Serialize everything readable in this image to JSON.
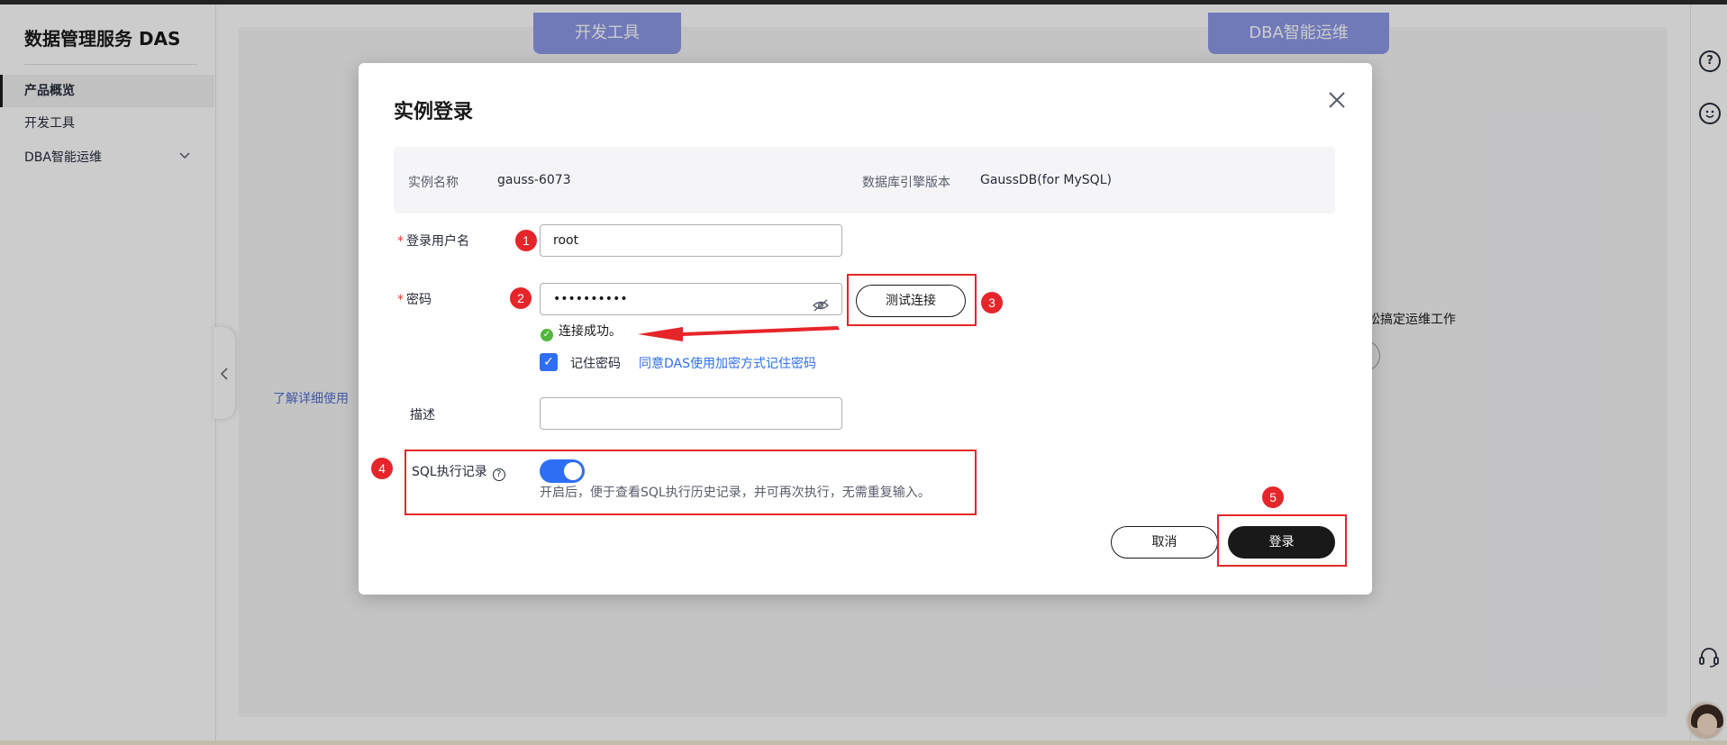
{
  "app": {
    "brand": "数据管理服务 DAS"
  },
  "sidebar": {
    "items": [
      {
        "label": "产品概览",
        "active": true
      },
      {
        "label": "开发工具",
        "active": false
      },
      {
        "label": "DBA智能运维",
        "active": false,
        "has_submenu": true
      }
    ]
  },
  "background": {
    "tabs": [
      "开发工具",
      "DBA智能运维"
    ],
    "learn_link": "了解详细使用",
    "right_text": "松搞定运维工作"
  },
  "modal": {
    "title": "实例登录",
    "info": {
      "instance_name_label": "实例名称",
      "instance_name_value": "gauss-6073",
      "engine_label": "数据库引擎版本",
      "engine_value": "GaussDB(for MySQL)"
    },
    "form": {
      "username_label": "登录用户名",
      "username_value": "root",
      "password_label": "密码",
      "password_value": "••••••••••",
      "test_button": "测试连接",
      "success_text": "连接成功。",
      "remember_label": "记住密码",
      "remember_checked": true,
      "agree_link": "同意DAS使用加密方式记住密码",
      "description_label": "描述",
      "description_value": "",
      "sql_label": "SQL执行记录",
      "sql_enabled": true,
      "sql_help": "开启后，便于查看SQL执行历史记录，并可再次执行，无需重复输入。"
    },
    "actions": {
      "cancel": "取消",
      "login": "登录"
    }
  },
  "annotations": [
    "1",
    "2",
    "3",
    "4",
    "5"
  ],
  "colors": {
    "primary": "#2e6ef4",
    "annotation": "#e6252a",
    "success": "#50b83c",
    "dark_button": "#191919"
  }
}
